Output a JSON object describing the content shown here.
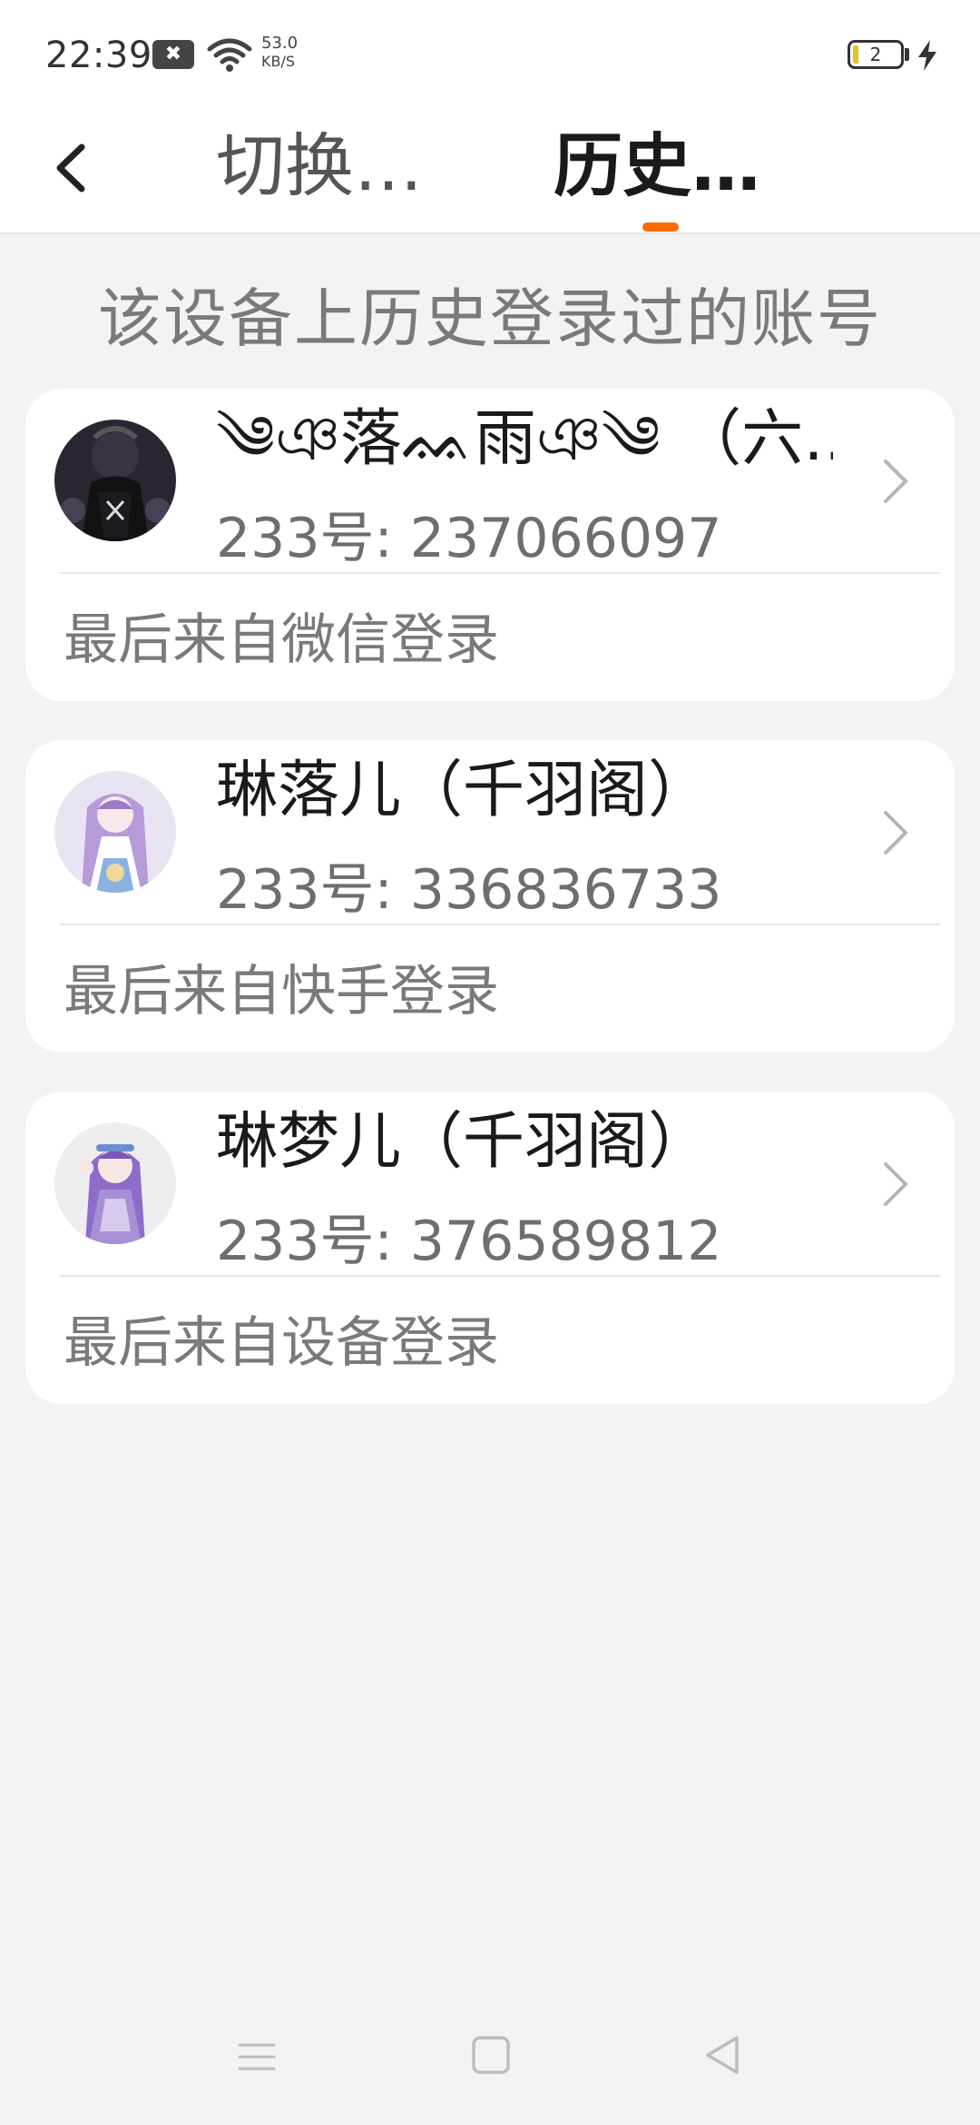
{
  "status_bar": {
    "time": "22:39",
    "net_speed_value": "53.0",
    "net_speed_unit": "KB/S",
    "battery_level": "2",
    "app_icon_glyph": "✖",
    "icons": [
      "notification-app-icon",
      "wifi-icon",
      "battery-icon",
      "charging-icon"
    ]
  },
  "header": {
    "tabs": [
      {
        "label": "切换…",
        "active": false
      },
      {
        "label": "历史…",
        "active": true
      }
    ],
    "accent_color": "#ff6a00"
  },
  "subtitle": "该设备上历史登录过的账号",
  "accounts": [
    {
      "name": "༄ঞ落ᨐ雨ঞ༄ （六…",
      "id_text": "233号: 237066097",
      "login_source": "最后来自微信登录",
      "avatar_icon": "avatar-dark-gothic-character"
    },
    {
      "name": "琳落儿（千羽阁）",
      "id_text": "233号: 336836733",
      "login_source": "最后来自快手登录",
      "avatar_icon": "avatar-purple-hair-character"
    },
    {
      "name": "琳梦儿（千羽阁）",
      "id_text": "233号: 376589812",
      "login_source": "最后来自设备登录",
      "avatar_icon": "avatar-purple-dress-character"
    }
  ],
  "nav_bar": {
    "icons": [
      "menu-icon",
      "home-icon",
      "back-triangle-icon"
    ]
  }
}
